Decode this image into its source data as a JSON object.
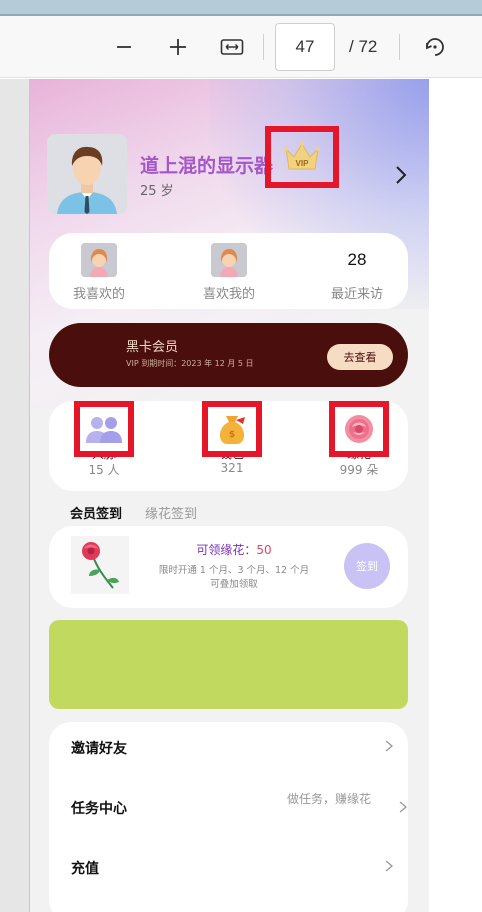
{
  "toolbar": {
    "zoom_out_symbol": "−",
    "zoom_in_symbol": "+",
    "page_current": "47",
    "page_total": "/ 72"
  },
  "profile": {
    "name": "道上混的显示器",
    "age": "25 岁",
    "vip_badge": "VIP"
  },
  "stats": [
    {
      "label": "我喜欢的",
      "value": ""
    },
    {
      "label": "喜欢我的",
      "value": ""
    },
    {
      "label": "最近来访",
      "value": "28"
    }
  ],
  "black_card": {
    "title": "黑卡会员",
    "expiry": "VIP 到期时间：2023 年 12 月 5 日",
    "button": "去查看"
  },
  "assets": [
    {
      "name": "人脉",
      "value": "15 人"
    },
    {
      "name": "钱包",
      "value": "321"
    },
    {
      "name": "缘花",
      "value": "999 朵"
    }
  ],
  "tabs": {
    "active": "会员签到",
    "inactive": "缘花签到"
  },
  "signin": {
    "title_prefix": "可领缘花：",
    "amount": "50",
    "line1": "限时开通 1 个月、3 个月、12 个月",
    "line2": "可叠加领取",
    "button": "签到"
  },
  "menu": [
    {
      "label": "邀请好友",
      "hint": ""
    },
    {
      "label": "任务中心",
      "hint": "做任务，赚缘花"
    },
    {
      "label": "充值",
      "hint": ""
    }
  ],
  "colors": {
    "vip_name": "#a457c6",
    "black_card_bg": "#4a0f0d",
    "banner": "#c1d95f",
    "highlight_box": "#e5162a",
    "signin_button": "#c9c2f4"
  }
}
